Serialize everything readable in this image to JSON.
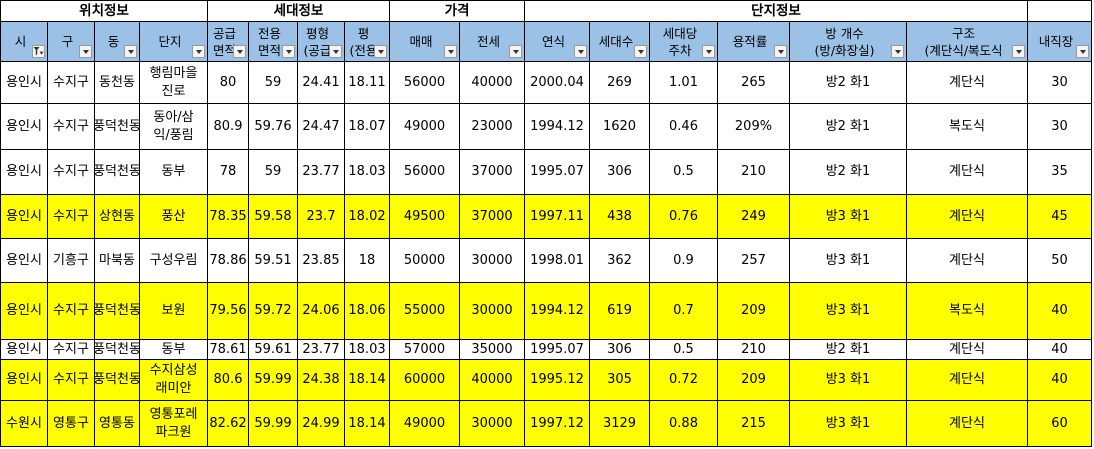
{
  "sheet": {
    "group_headers": [
      "위치정보",
      "세대정보",
      "가격",
      "단지정보"
    ],
    "columns": [
      {
        "label": "시",
        "filter_active": true
      },
      {
        "label": "구"
      },
      {
        "label": "동"
      },
      {
        "label": "단지"
      },
      {
        "label": "공급\n면적"
      },
      {
        "label": "전용\n면적"
      },
      {
        "label": "평형\n(공급"
      },
      {
        "label": "평\n(전용"
      },
      {
        "label": "매매"
      },
      {
        "label": "전세"
      },
      {
        "label": "연식"
      },
      {
        "label": "세대수"
      },
      {
        "label": "세대당\n주차"
      },
      {
        "label": "용적률"
      },
      {
        "label": "방 개수\n(방/화장실)"
      },
      {
        "label": "구조\n(계단식/복도식"
      },
      {
        "label": "내직장"
      }
    ],
    "rows": [
      {
        "highlight": false,
        "cells": [
          "용인시",
          "수지구",
          "동천동",
          "행림마을\n진로",
          "80",
          "59",
          "24.41",
          "18.11",
          "56000",
          "40000",
          "2000.04",
          "269",
          "1.01",
          "265",
          "방2 화1",
          "계단식",
          "30"
        ]
      },
      {
        "highlight": false,
        "cells": [
          "용인시",
          "수지구",
          "풍덕천동",
          "동아/삼\n익/풍림",
          "80.9",
          "59.76",
          "24.47",
          "18.07",
          "49000",
          "23000",
          "1994.12",
          "1620",
          "0.46",
          "209%",
          "방2 화1",
          "복도식",
          "30"
        ]
      },
      {
        "highlight": false,
        "cells": [
          "용인시",
          "수지구",
          "풍덕천동",
          "동부",
          "78",
          "59",
          "23.77",
          "18.03",
          "56000",
          "37000",
          "1995.07",
          "306",
          "0.5",
          "210",
          "방2 화1",
          "계단식",
          "35"
        ]
      },
      {
        "highlight": true,
        "cells": [
          "용인시",
          "수지구",
          "상현동",
          "풍산",
          "78.35",
          "59.58",
          "23.7",
          "18.02",
          "49500",
          "37000",
          "1997.11",
          "438",
          "0.76",
          "249",
          "방3 화1",
          "계단식",
          "45"
        ]
      },
      {
        "highlight": false,
        "cells": [
          "용인시",
          "기흥구",
          "마북동",
          "구성우림",
          "78.86",
          "59.51",
          "23.85",
          "18",
          "50000",
          "30000",
          "1998.01",
          "362",
          "0.9",
          "257",
          "방3 화1",
          "계단식",
          "50"
        ]
      },
      {
        "highlight": true,
        "cells": [
          "용인시",
          "수지구",
          "풍덕천동",
          "보원",
          "79.56",
          "59.72",
          "24.06",
          "18.06",
          "55000",
          "30000",
          "1994.12",
          "619",
          "0.7",
          "209",
          "방3 화1",
          "복도식",
          "40"
        ]
      },
      {
        "highlight": false,
        "cells": [
          "용인시",
          "수지구",
          "풍덕천동",
          "동부",
          "78.61",
          "59.61",
          "23.77",
          "18.03",
          "57000",
          "35000",
          "1995.07",
          "306",
          "0.5",
          "210",
          "방2 화1",
          "계단식",
          "40"
        ]
      },
      {
        "highlight": true,
        "cells": [
          "용인시",
          "수지구",
          "풍덕천동",
          "수지삼성\n래미안",
          "80.6",
          "59.99",
          "24.38",
          "18.14",
          "60000",
          "40000",
          "1995.12",
          "305",
          "0.72",
          "209",
          "방3 화1",
          "계단식",
          "40"
        ]
      },
      {
        "highlight": true,
        "cells": [
          "수원시",
          "영통구",
          "영통동",
          "영통포레\n파크원",
          "82.62",
          "59.99",
          "24.99",
          "18.14",
          "49000",
          "30000",
          "1997.12",
          "3129",
          "0.88",
          "215",
          "방3 화1",
          "계단식",
          "60"
        ]
      }
    ]
  },
  "colors": {
    "header_fill": "#9BC2E6",
    "highlight_fill": "#FFFF00"
  }
}
